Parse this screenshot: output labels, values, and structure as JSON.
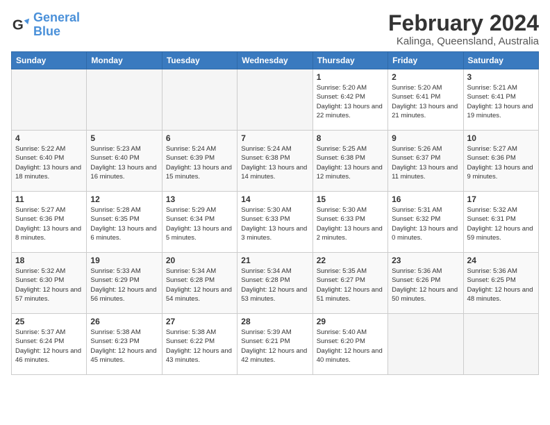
{
  "logo": {
    "general": "General",
    "blue": "Blue"
  },
  "header": {
    "title": "February 2024",
    "subtitle": "Kalinga, Queensland, Australia"
  },
  "weekdays": [
    "Sunday",
    "Monday",
    "Tuesday",
    "Wednesday",
    "Thursday",
    "Friday",
    "Saturday"
  ],
  "weeks": [
    [
      {
        "day": "",
        "sunrise": "",
        "sunset": "",
        "daylight": ""
      },
      {
        "day": "",
        "sunrise": "",
        "sunset": "",
        "daylight": ""
      },
      {
        "day": "",
        "sunrise": "",
        "sunset": "",
        "daylight": ""
      },
      {
        "day": "",
        "sunrise": "",
        "sunset": "",
        "daylight": ""
      },
      {
        "day": "1",
        "sunrise": "Sunrise: 5:20 AM",
        "sunset": "Sunset: 6:42 PM",
        "daylight": "Daylight: 13 hours and 22 minutes."
      },
      {
        "day": "2",
        "sunrise": "Sunrise: 5:20 AM",
        "sunset": "Sunset: 6:41 PM",
        "daylight": "Daylight: 13 hours and 21 minutes."
      },
      {
        "day": "3",
        "sunrise": "Sunrise: 5:21 AM",
        "sunset": "Sunset: 6:41 PM",
        "daylight": "Daylight: 13 hours and 19 minutes."
      }
    ],
    [
      {
        "day": "4",
        "sunrise": "Sunrise: 5:22 AM",
        "sunset": "Sunset: 6:40 PM",
        "daylight": "Daylight: 13 hours and 18 minutes."
      },
      {
        "day": "5",
        "sunrise": "Sunrise: 5:23 AM",
        "sunset": "Sunset: 6:40 PM",
        "daylight": "Daylight: 13 hours and 16 minutes."
      },
      {
        "day": "6",
        "sunrise": "Sunrise: 5:24 AM",
        "sunset": "Sunset: 6:39 PM",
        "daylight": "Daylight: 13 hours and 15 minutes."
      },
      {
        "day": "7",
        "sunrise": "Sunrise: 5:24 AM",
        "sunset": "Sunset: 6:38 PM",
        "daylight": "Daylight: 13 hours and 14 minutes."
      },
      {
        "day": "8",
        "sunrise": "Sunrise: 5:25 AM",
        "sunset": "Sunset: 6:38 PM",
        "daylight": "Daylight: 13 hours and 12 minutes."
      },
      {
        "day": "9",
        "sunrise": "Sunrise: 5:26 AM",
        "sunset": "Sunset: 6:37 PM",
        "daylight": "Daylight: 13 hours and 11 minutes."
      },
      {
        "day": "10",
        "sunrise": "Sunrise: 5:27 AM",
        "sunset": "Sunset: 6:36 PM",
        "daylight": "Daylight: 13 hours and 9 minutes."
      }
    ],
    [
      {
        "day": "11",
        "sunrise": "Sunrise: 5:27 AM",
        "sunset": "Sunset: 6:36 PM",
        "daylight": "Daylight: 13 hours and 8 minutes."
      },
      {
        "day": "12",
        "sunrise": "Sunrise: 5:28 AM",
        "sunset": "Sunset: 6:35 PM",
        "daylight": "Daylight: 13 hours and 6 minutes."
      },
      {
        "day": "13",
        "sunrise": "Sunrise: 5:29 AM",
        "sunset": "Sunset: 6:34 PM",
        "daylight": "Daylight: 13 hours and 5 minutes."
      },
      {
        "day": "14",
        "sunrise": "Sunrise: 5:30 AM",
        "sunset": "Sunset: 6:33 PM",
        "daylight": "Daylight: 13 hours and 3 minutes."
      },
      {
        "day": "15",
        "sunrise": "Sunrise: 5:30 AM",
        "sunset": "Sunset: 6:33 PM",
        "daylight": "Daylight: 13 hours and 2 minutes."
      },
      {
        "day": "16",
        "sunrise": "Sunrise: 5:31 AM",
        "sunset": "Sunset: 6:32 PM",
        "daylight": "Daylight: 13 hours and 0 minutes."
      },
      {
        "day": "17",
        "sunrise": "Sunrise: 5:32 AM",
        "sunset": "Sunset: 6:31 PM",
        "daylight": "Daylight: 12 hours and 59 minutes."
      }
    ],
    [
      {
        "day": "18",
        "sunrise": "Sunrise: 5:32 AM",
        "sunset": "Sunset: 6:30 PM",
        "daylight": "Daylight: 12 hours and 57 minutes."
      },
      {
        "day": "19",
        "sunrise": "Sunrise: 5:33 AM",
        "sunset": "Sunset: 6:29 PM",
        "daylight": "Daylight: 12 hours and 56 minutes."
      },
      {
        "day": "20",
        "sunrise": "Sunrise: 5:34 AM",
        "sunset": "Sunset: 6:28 PM",
        "daylight": "Daylight: 12 hours and 54 minutes."
      },
      {
        "day": "21",
        "sunrise": "Sunrise: 5:34 AM",
        "sunset": "Sunset: 6:28 PM",
        "daylight": "Daylight: 12 hours and 53 minutes."
      },
      {
        "day": "22",
        "sunrise": "Sunrise: 5:35 AM",
        "sunset": "Sunset: 6:27 PM",
        "daylight": "Daylight: 12 hours and 51 minutes."
      },
      {
        "day": "23",
        "sunrise": "Sunrise: 5:36 AM",
        "sunset": "Sunset: 6:26 PM",
        "daylight": "Daylight: 12 hours and 50 minutes."
      },
      {
        "day": "24",
        "sunrise": "Sunrise: 5:36 AM",
        "sunset": "Sunset: 6:25 PM",
        "daylight": "Daylight: 12 hours and 48 minutes."
      }
    ],
    [
      {
        "day": "25",
        "sunrise": "Sunrise: 5:37 AM",
        "sunset": "Sunset: 6:24 PM",
        "daylight": "Daylight: 12 hours and 46 minutes."
      },
      {
        "day": "26",
        "sunrise": "Sunrise: 5:38 AM",
        "sunset": "Sunset: 6:23 PM",
        "daylight": "Daylight: 12 hours and 45 minutes."
      },
      {
        "day": "27",
        "sunrise": "Sunrise: 5:38 AM",
        "sunset": "Sunset: 6:22 PM",
        "daylight": "Daylight: 12 hours and 43 minutes."
      },
      {
        "day": "28",
        "sunrise": "Sunrise: 5:39 AM",
        "sunset": "Sunset: 6:21 PM",
        "daylight": "Daylight: 12 hours and 42 minutes."
      },
      {
        "day": "29",
        "sunrise": "Sunrise: 5:40 AM",
        "sunset": "Sunset: 6:20 PM",
        "daylight": "Daylight: 12 hours and 40 minutes."
      },
      {
        "day": "",
        "sunrise": "",
        "sunset": "",
        "daylight": ""
      },
      {
        "day": "",
        "sunrise": "",
        "sunset": "",
        "daylight": ""
      }
    ]
  ]
}
